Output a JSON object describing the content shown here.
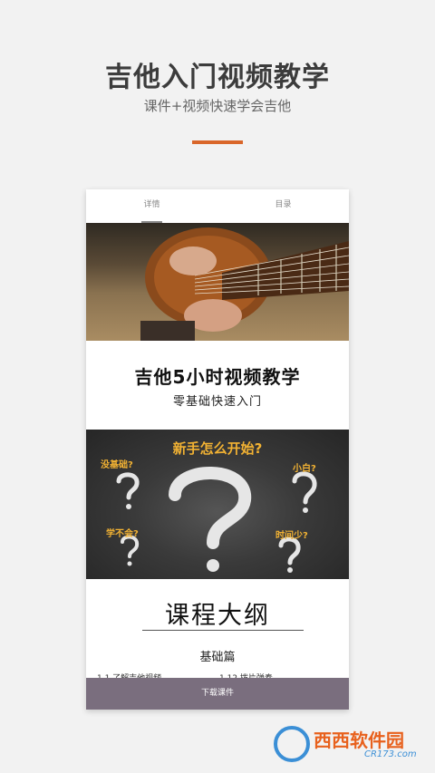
{
  "header": {
    "title": "吉他入门视频教学",
    "subtitle": "课件+视频快速学会吉他"
  },
  "tabs": [
    {
      "label": "详情",
      "active": true
    },
    {
      "label": "目录",
      "active": false
    }
  ],
  "course": {
    "title": "吉他5小时视频教学",
    "subtitle": "零基础快速入门"
  },
  "chalkboard": {
    "headline": "新手怎么开始?",
    "tags": [
      "没基础?",
      "小白?",
      "学不会?",
      "时间少?"
    ]
  },
  "outline": {
    "title": "课程大纲",
    "section": "基础篇",
    "lessons": [
      "1.1 了解吉他视频",
      "1.12 拨片弹奏"
    ]
  },
  "footer": {
    "download_label": "下载课件"
  },
  "watermark": {
    "brand": "西西软件园",
    "site": "CR173.com"
  },
  "colors": {
    "accent": "#d9662a",
    "chalk_text": "#f2b233",
    "download_bar": "#7a6e7e"
  }
}
